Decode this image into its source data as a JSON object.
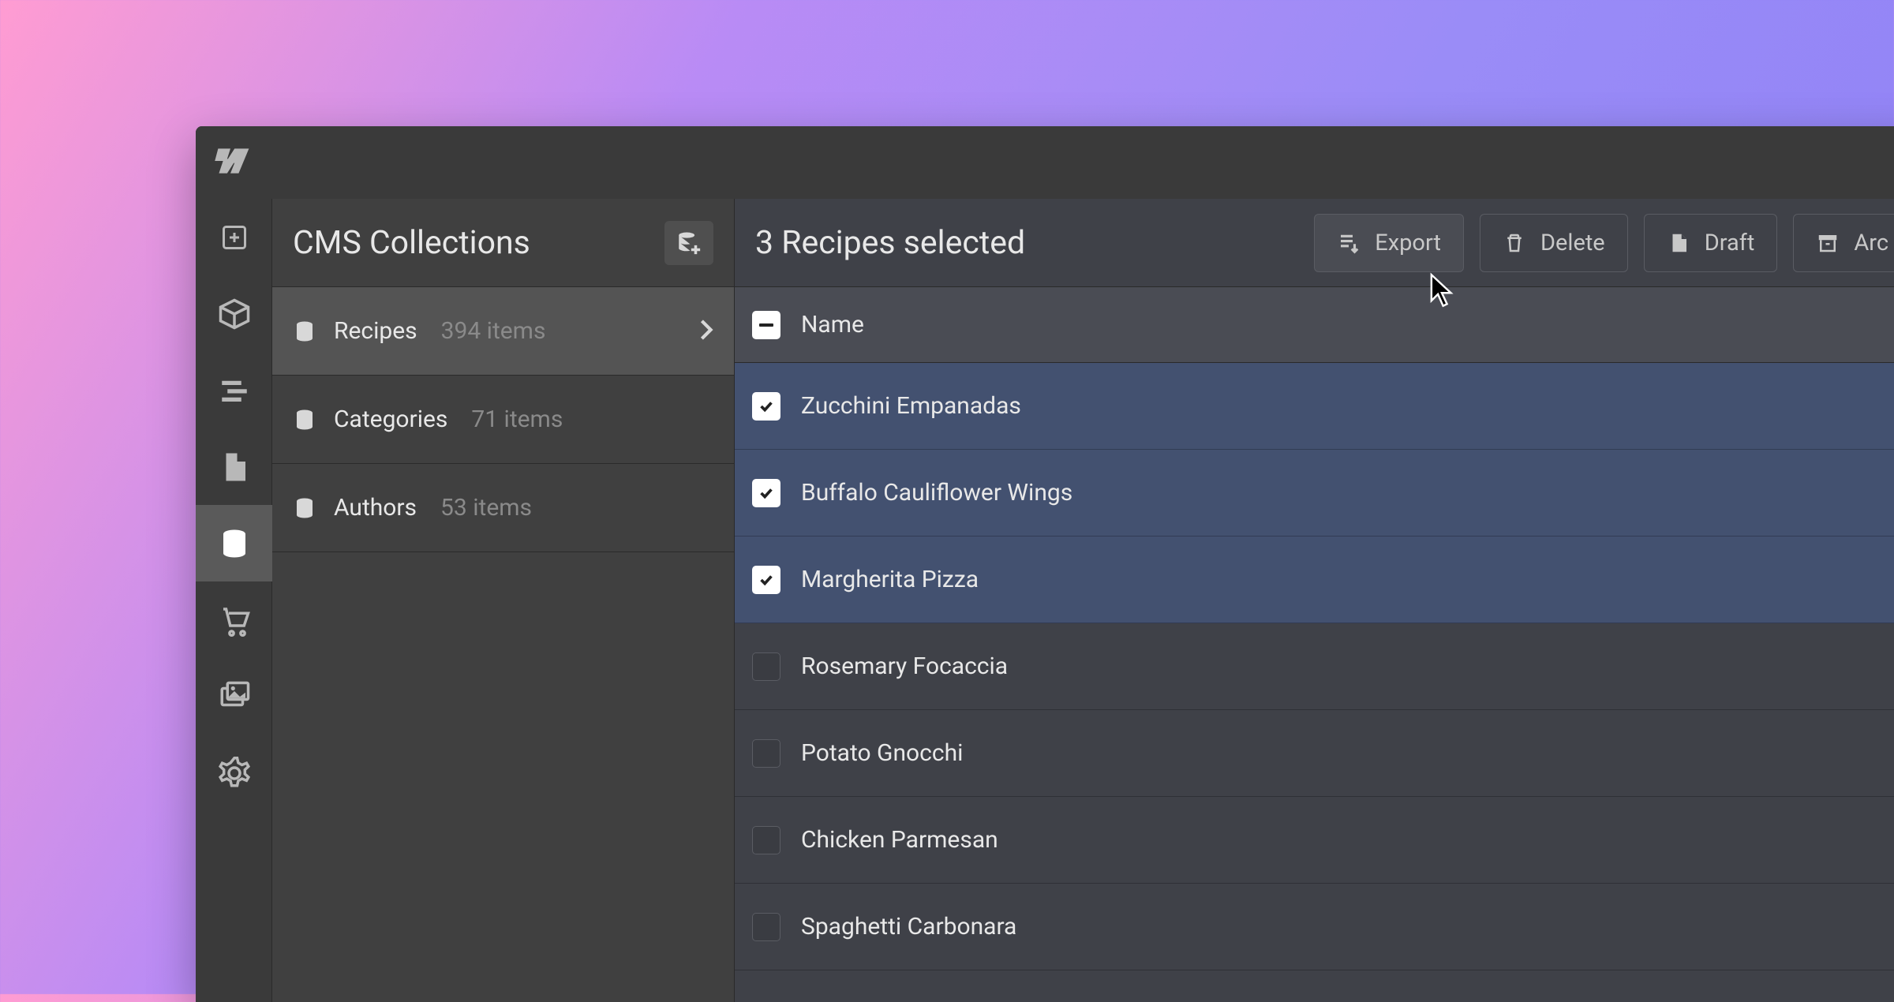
{
  "sidebar": {
    "title": "CMS Collections",
    "collections": [
      {
        "name": "Recipes",
        "count": "394 items",
        "active": true
      },
      {
        "name": "Categories",
        "count": "71 items",
        "active": false
      },
      {
        "name": "Authors",
        "count": "53 items",
        "active": false
      }
    ]
  },
  "main": {
    "selection_text": "3 Recipes selected",
    "actions": {
      "export": "Export",
      "delete": "Delete",
      "draft": "Draft",
      "archive": "Arc"
    },
    "column_header": "Name",
    "rows": [
      {
        "name": "Zucchini Empanadas",
        "selected": true
      },
      {
        "name": "Buffalo Cauliflower Wings",
        "selected": true
      },
      {
        "name": "Margherita Pizza",
        "selected": true
      },
      {
        "name": "Rosemary Focaccia",
        "selected": false
      },
      {
        "name": "Potato Gnocchi",
        "selected": false
      },
      {
        "name": "Chicken Parmesan",
        "selected": false
      },
      {
        "name": "Spaghetti Carbonara",
        "selected": false
      }
    ]
  }
}
